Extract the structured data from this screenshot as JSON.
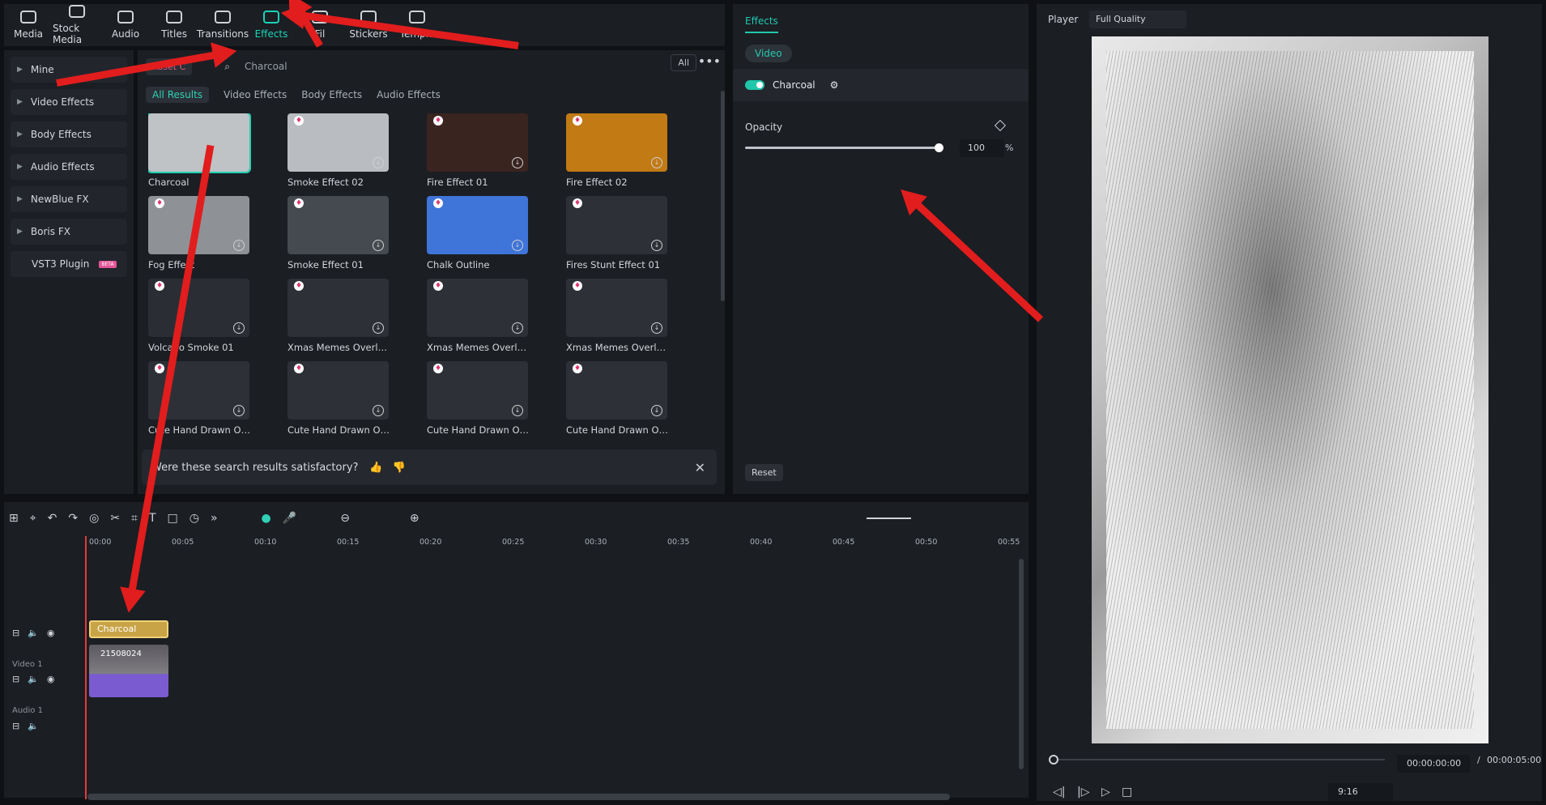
{
  "toptabs": [
    "Media",
    "Stock Media",
    "Audio",
    "Titles",
    "Transitions",
    "Effects",
    "Fil",
    "Stickers",
    "Templa"
  ],
  "sidebar": [
    "Mine",
    "Video Effects",
    "Body Effects",
    "Audio Effects",
    "NewBlue FX",
    "Boris FX",
    "VST3 Plugin"
  ],
  "sidebar_badge": "BETA",
  "search": {
    "asset": "Asset C",
    "query": "Charcoal",
    "all": "All",
    "more": "•••"
  },
  "filters": [
    "All Results",
    "Video Effects",
    "Body Effects",
    "Audio Effects"
  ],
  "cards": [
    {
      "label": "Charcoal",
      "bg": "#bfc3c6"
    },
    {
      "label": "Smoke Effect 02",
      "bg": "#b9bcc0"
    },
    {
      "label": "Fire Effect 01",
      "bg": "#3a2420"
    },
    {
      "label": "Fire Effect 02",
      "bg": "#c27a14"
    },
    {
      "label": "Fog Effect",
      "bg": "#8e9297"
    },
    {
      "label": "Smoke Effect 01",
      "bg": "#454a50"
    },
    {
      "label": "Chalk Outline",
      "bg": "#3f74d9"
    },
    {
      "label": "Fires Stunt Effect 01",
      "bg": "#2d3036"
    },
    {
      "label": "Volcano Smoke 01",
      "bg": "#2a2e34"
    },
    {
      "label": "Xmas Memes Overlay ...",
      "bg": "#2d3137"
    },
    {
      "label": "Xmas Memes Overlay ...",
      "bg": "#2d3137"
    },
    {
      "label": "Xmas Memes Overlay ...",
      "bg": "#2d3137"
    },
    {
      "label": "Cute Hand Drawn Ove...",
      "bg": "#2d3137"
    },
    {
      "label": "Cute Hand Drawn Ove...",
      "bg": "#2d3137"
    },
    {
      "label": "Cute Hand Drawn Ove...",
      "bg": "#2d3137"
    },
    {
      "label": "Cute Hand Drawn Ove...",
      "bg": "#2d3137"
    }
  ],
  "feedback": "Were these search results satisfactory?",
  "props": {
    "tab": "Effects",
    "video": "Video",
    "effect": "Charcoal",
    "opacity_label": "Opacity",
    "opacity_value": "100",
    "unit": "%",
    "reset": "Reset"
  },
  "player": {
    "label": "Player",
    "quality": "Full Quality",
    "time_current": "00:00:00:00",
    "time_sep": "/",
    "time_total": "00:00:05:00",
    "ratio": "9:16"
  },
  "ruler": [
    "00:00",
    "00:05",
    "00:10",
    "00:15",
    "00:20",
    "00:25",
    "00:30",
    "00:35",
    "00:40",
    "00:45",
    "00:50",
    "00:55"
  ],
  "tracks": {
    "fx_clip": "Charcoal",
    "video_clip": "21508024",
    "video_label": "Video 1",
    "audio_label": "Audio 1"
  }
}
